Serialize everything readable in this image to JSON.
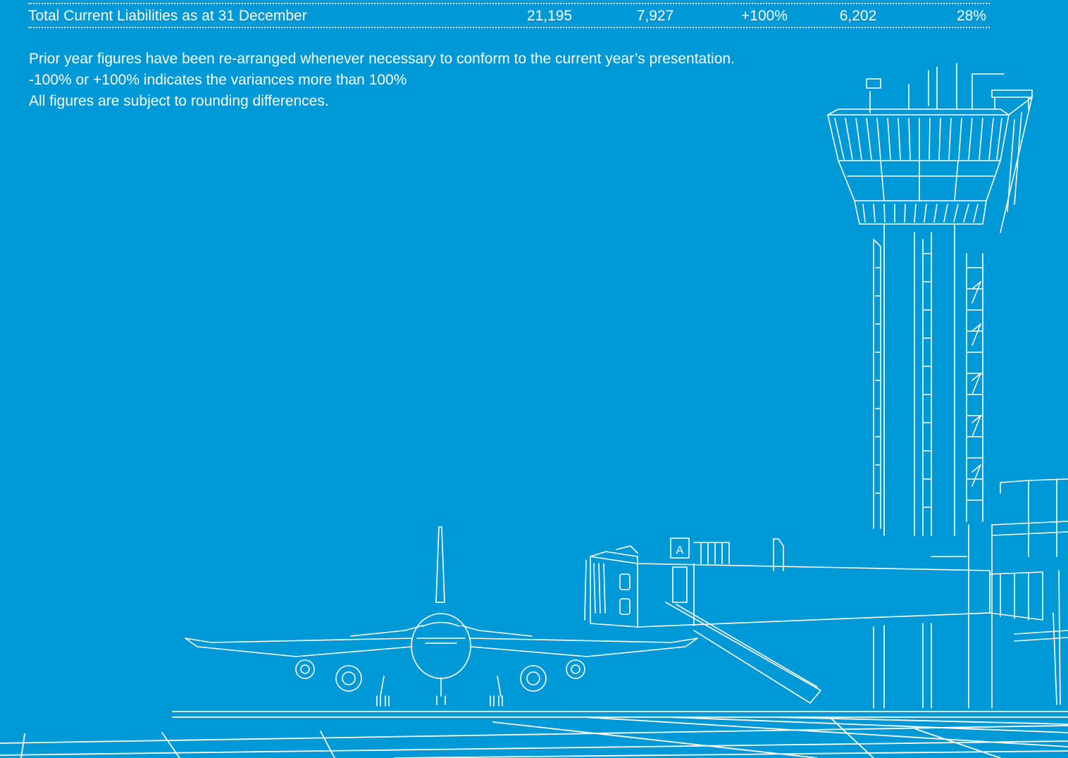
{
  "table": {
    "row": {
      "label": "Total Current Liabilities as at 31 December",
      "value_1": "21,195",
      "value_2": "7,927",
      "variance_1": "+100%",
      "value_3": "6,202",
      "variance_2": "28%"
    }
  },
  "notes": [
    "Prior year figures have been re-arranged whenever necessary to conform to the current year’s presentation.",
    "-100% or +100% indicates the variances more than 100%",
    "All figures are subject to rounding differences."
  ],
  "illustration": {
    "gate_letter": "A"
  },
  "colors": {
    "background": "#0099d8",
    "foreground": "#ffffff"
  }
}
